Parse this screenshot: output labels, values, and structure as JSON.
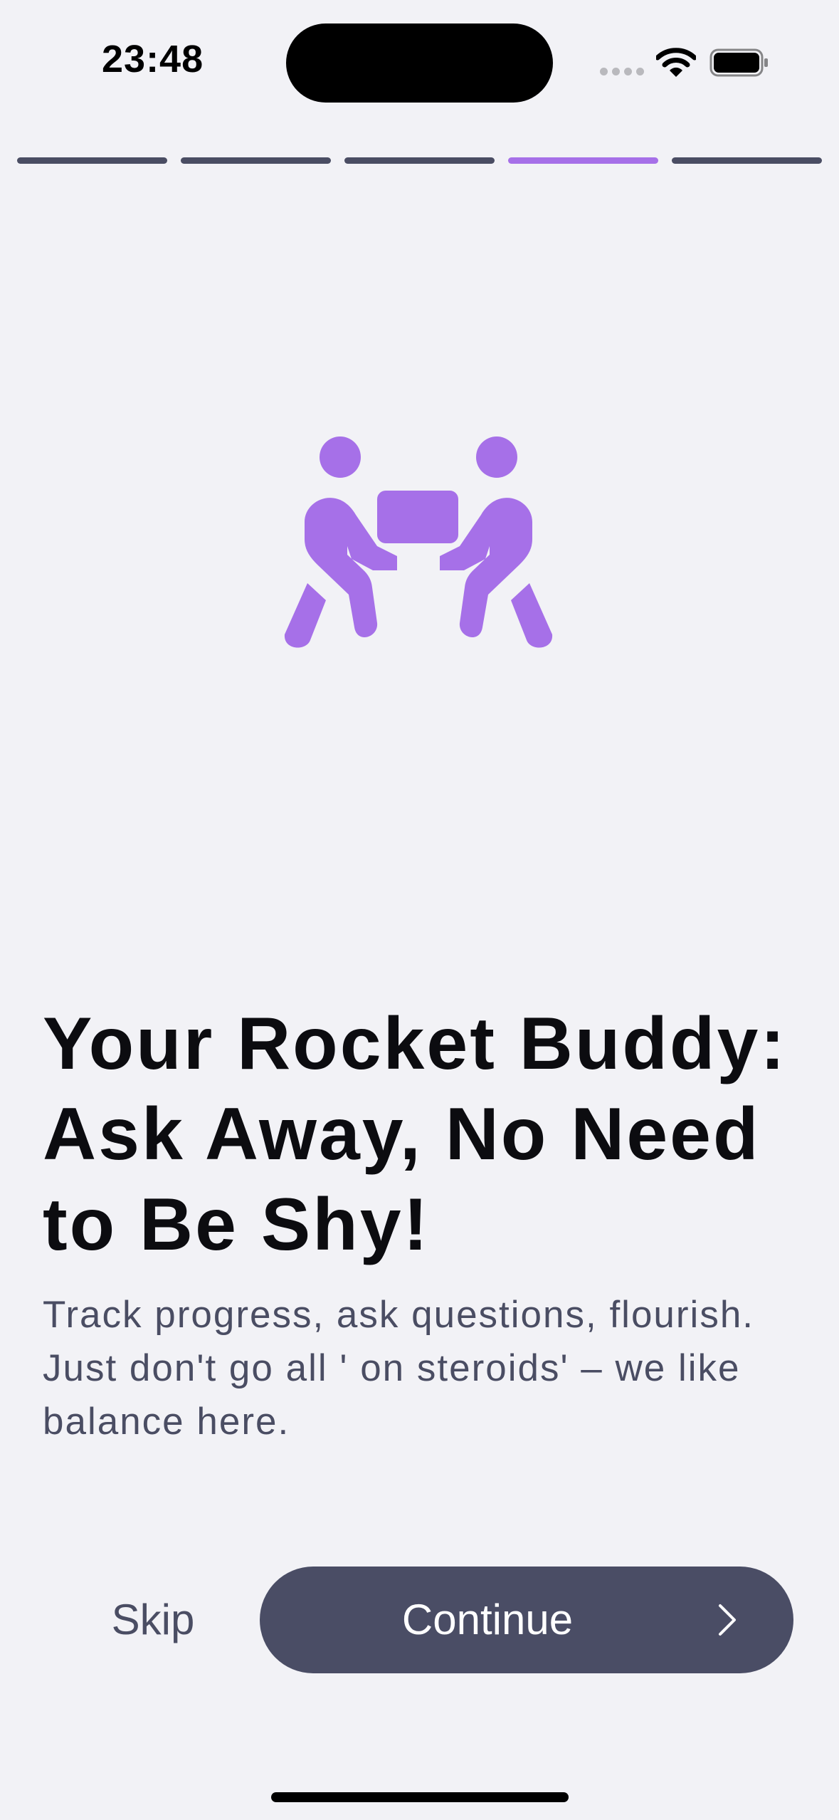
{
  "status_bar": {
    "time": "23:48",
    "icons": [
      "cellular-signal-icon",
      "wifi-icon",
      "battery-icon"
    ]
  },
  "onboarding": {
    "step_count": 5,
    "current_step": 4,
    "illustration_icon": "people-carrying-box-icon",
    "title": "Your Rocket Buddy: Ask Away, No Need to Be Shy!",
    "subtitle": "Track progress, ask questions, flourish. Just don't go all ' on steroids' – we like balance here."
  },
  "actions": {
    "skip_label": "Skip",
    "continue_label": "Continue",
    "continue_icon": "chevron-right-icon"
  },
  "colors": {
    "accent": "#a670e8",
    "button": "#4a4d65",
    "background": "#f2f2f6",
    "text_primary": "#0c0c10",
    "text_secondary": "#4a4d63"
  }
}
